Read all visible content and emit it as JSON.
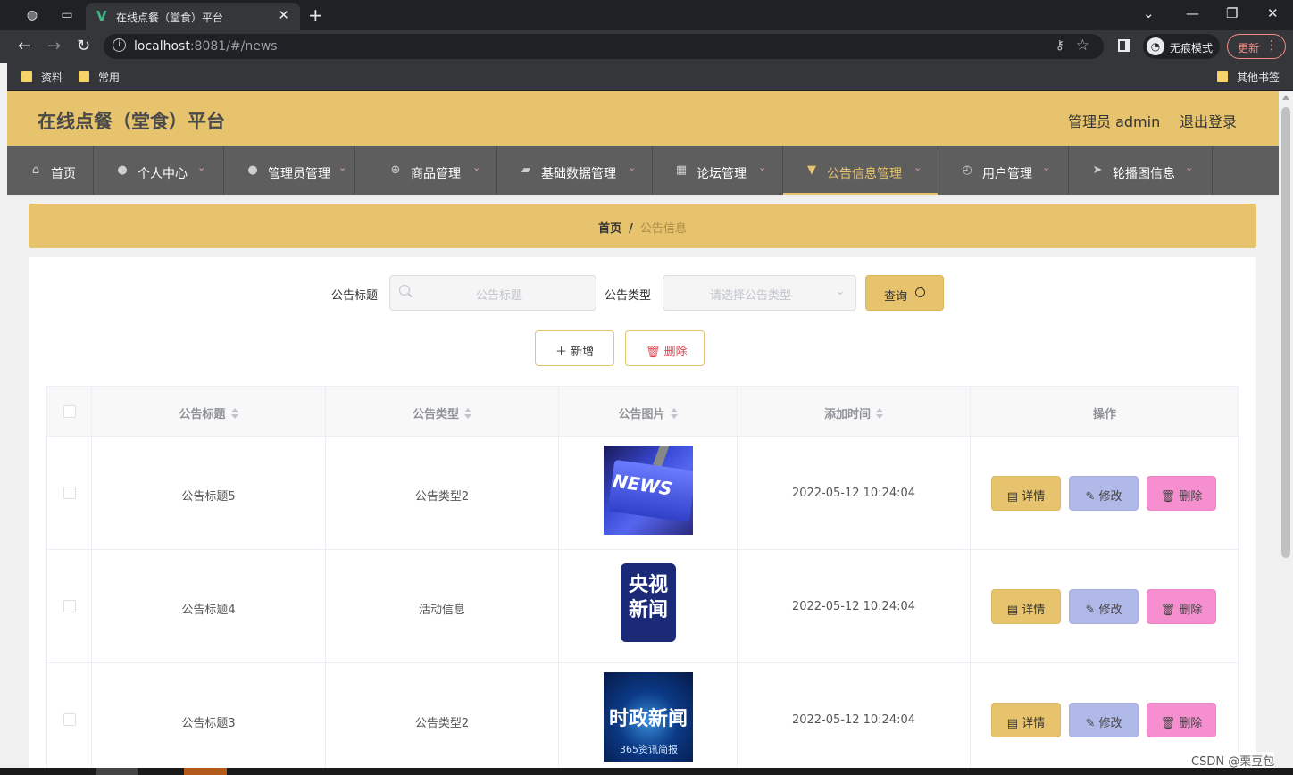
{
  "browser": {
    "tab_title": "在线点餐（堂食）平台",
    "url_host": "localhost",
    "url_rest": ":8081/#/news",
    "incognito_label": "无痕模式",
    "update_label": "更新",
    "bookmarks": [
      "资料",
      "常用"
    ],
    "other_bookmarks": "其他书签"
  },
  "header": {
    "site_title": "在线点餐（堂食）平台",
    "admin_label": "管理员 admin",
    "logout_label": "退出登录"
  },
  "nav": {
    "items": [
      {
        "label": "首页",
        "icon": "home-icon"
      },
      {
        "label": "个人中心",
        "icon": "user-icon"
      },
      {
        "label": "管理员管理",
        "icon": "user-icon"
      },
      {
        "label": "商品管理",
        "icon": "target-icon"
      },
      {
        "label": "基础数据管理",
        "icon": "briefcase-icon"
      },
      {
        "label": "论坛管理",
        "icon": "grid-icon"
      },
      {
        "label": "公告信息管理",
        "icon": "pin-icon"
      },
      {
        "label": "用户管理",
        "icon": "gauge-icon"
      },
      {
        "label": "轮播图信息",
        "icon": "send-icon"
      }
    ],
    "active_index": 6
  },
  "breadcrumb": {
    "home": "首页",
    "separator": "/",
    "current": "公告信息"
  },
  "search": {
    "title_label": "公告标题",
    "title_placeholder": "公告标题",
    "type_label": "公告类型",
    "type_placeholder": "请选择公告类型",
    "query_label": "查询"
  },
  "actions": {
    "add_label": "新增",
    "delete_label": "删除"
  },
  "table": {
    "columns": [
      "公告标题",
      "公告类型",
      "公告图片",
      "添加时间",
      "操作"
    ],
    "rows": [
      {
        "title": "公告标题5",
        "type": "公告类型2",
        "image": "NEWS",
        "time": "2022-05-12 10:24:04"
      },
      {
        "title": "公告标题4",
        "type": "活动信息",
        "image": "央视新闻",
        "time": "2022-05-12 10:24:04"
      },
      {
        "title": "公告标题3",
        "type": "公告类型2",
        "image": "时政新闻",
        "image_sub": "365资讯简报",
        "time": "2022-05-12 10:24:04"
      }
    ],
    "row_actions": {
      "detail": "详情",
      "edit": "修改",
      "delete": "删除"
    }
  },
  "watermark": "CSDN @栗豆包",
  "colors": {
    "accent": "#e6c36c",
    "nav_bg": "#5e5e5e",
    "edit_btn": "#b1b9e8",
    "delete_btn": "#f58fcf"
  }
}
